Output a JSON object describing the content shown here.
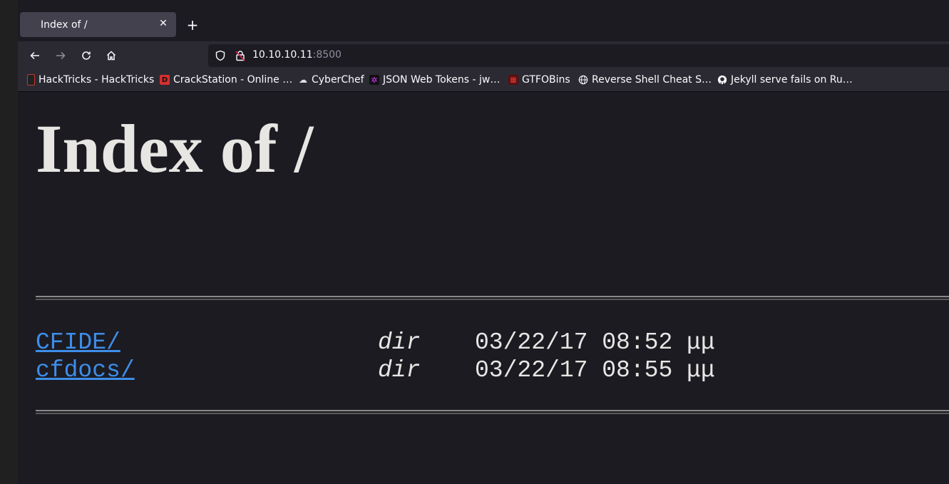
{
  "tab": {
    "title": "Index of /",
    "close_glyph": "✕",
    "new_tab_glyph": "+"
  },
  "nav": {
    "back_icon": "back-arrow-icon",
    "forward_icon": "forward-arrow-icon",
    "reload_icon": "reload-icon",
    "home_icon": "home-icon"
  },
  "url": {
    "host": "10.10.10.11",
    "port": ":8500"
  },
  "bookmarks": [
    {
      "label": "HackTricks - HackTricks",
      "icon": "hacktricks-icon",
      "color": "#c0392b"
    },
    {
      "label": "CrackStation - Online …",
      "icon": "crackstation-icon",
      "color": "#d32f2f"
    },
    {
      "label": "CyberChef",
      "icon": "chef-hat-icon",
      "color": "#e0e0e0"
    },
    {
      "label": "JSON Web Tokens - jw…",
      "icon": "jwt-icon",
      "color": "#d63aff"
    },
    {
      "label": "GTFOBins",
      "icon": "gtfobins-icon",
      "color": "#b71c1c"
    },
    {
      "label": "Reverse Shell Cheat S…",
      "icon": "globe-icon",
      "color": "#fbfbfe"
    },
    {
      "label": "Jekyll serve fails on Ru…",
      "icon": "github-icon",
      "color": "#fbfbfe"
    }
  ],
  "page": {
    "heading": "Index of /",
    "entries": [
      {
        "name": "CFIDE/",
        "type": "dir",
        "date": "03/22/17 08:52 μμ"
      },
      {
        "name": "cfdocs/",
        "type": "dir",
        "date": "03/22/17 08:55 μμ"
      }
    ]
  },
  "colors": {
    "link": "#3d8ee8",
    "background": "#1c1b22",
    "text": "#e8e6e3"
  }
}
